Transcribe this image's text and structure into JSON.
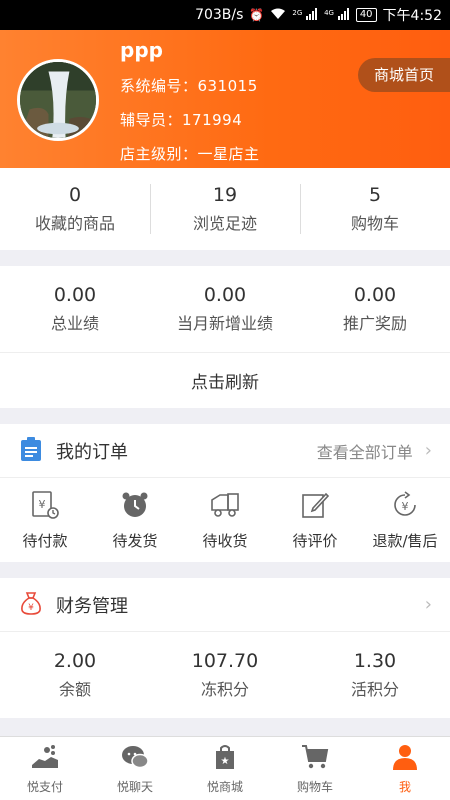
{
  "status_bar": {
    "speed": "703B/s",
    "battery": "40",
    "time": "下午4:52",
    "net1": "2G",
    "net2": "4G"
  },
  "header": {
    "username": "ppp",
    "system_no": "系统编号：631015",
    "mentor": "辅导员：171994",
    "level": "店主级别：一星店主",
    "mall_button": "商城首页"
  },
  "stats": [
    {
      "value": "0",
      "label": "收藏的商品"
    },
    {
      "value": "19",
      "label": "浏览足迹"
    },
    {
      "value": "5",
      "label": "购物车"
    }
  ],
  "performance": {
    "items": [
      {
        "value": "0.00",
        "label": "总业绩"
      },
      {
        "value": "0.00",
        "label": "当月新增业绩"
      },
      {
        "value": "0.00",
        "label": "推广奖励"
      }
    ],
    "refresh_label": "点击刷新"
  },
  "orders": {
    "title": "我的订单",
    "view_all": "查看全部订单",
    "items": [
      {
        "label": "待付款",
        "icon": "pending-payment-icon"
      },
      {
        "label": "待发货",
        "icon": "alarm-clock-icon"
      },
      {
        "label": "待收货",
        "icon": "delivery-truck-icon"
      },
      {
        "label": "待评价",
        "icon": "edit-review-icon"
      },
      {
        "label": "退款/售后",
        "icon": "refund-icon"
      }
    ]
  },
  "finance": {
    "title": "财务管理",
    "items": [
      {
        "value": "2.00",
        "label": "余额"
      },
      {
        "value": "107.70",
        "label": "冻积分"
      },
      {
        "value": "1.30",
        "label": "活积分"
      }
    ]
  },
  "tabbar": [
    {
      "label": "悦支付",
      "icon": "pay-icon"
    },
    {
      "label": "悦聊天",
      "icon": "chat-icon"
    },
    {
      "label": "悦商城",
      "icon": "shopping-bag-icon"
    },
    {
      "label": "购物车",
      "icon": "cart-icon"
    },
    {
      "label": "我",
      "icon": "user-icon",
      "active": true
    }
  ],
  "colors": {
    "accent": "#ff5e10",
    "header_gradient_start": "#ff8230",
    "mall_button_bg": "#b0501a",
    "icon_gray": "#666666",
    "order_icon_blue": "#3d8be0",
    "finance_icon_red": "#e84a3a"
  }
}
